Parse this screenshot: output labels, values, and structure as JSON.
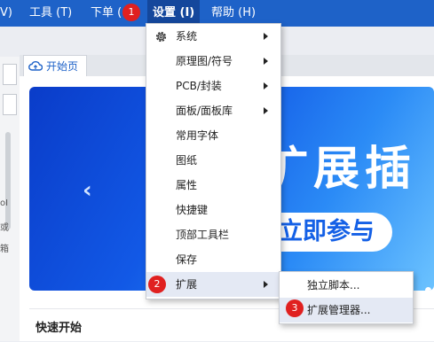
{
  "menubar": {
    "partial_item": "V)",
    "tools": "工具 (T)",
    "order": "下单 (",
    "settings": "设置 (I)",
    "help": "帮助 (H)"
  },
  "badges": [
    "1",
    "2",
    "3"
  ],
  "tab": {
    "label": "开始页"
  },
  "left_panel": {
    "text1": "oI",
    "text2": "或",
    "text3": "箱"
  },
  "settings_menu": {
    "items": [
      {
        "label": "系统",
        "has_submenu": true
      },
      {
        "label": "原理图/符号",
        "has_submenu": true
      },
      {
        "label": "PCB/封装",
        "has_submenu": true
      },
      {
        "label": "面板/面板库",
        "has_submenu": true
      },
      {
        "label": "常用字体",
        "has_submenu": false
      },
      {
        "label": "图纸",
        "has_submenu": false
      },
      {
        "label": "属性",
        "has_submenu": false
      },
      {
        "label": "快捷键",
        "has_submenu": false
      },
      {
        "label": "顶部工具栏",
        "has_submenu": false
      },
      {
        "label": "保存",
        "has_submenu": false
      },
      {
        "label": "扩展",
        "has_submenu": true
      }
    ]
  },
  "extension_submenu": {
    "items": [
      {
        "label": "独立脚本..."
      },
      {
        "label": "扩展管理器..."
      }
    ]
  },
  "banner": {
    "headline": "扩展插",
    "pill_text": "立即参与",
    "nav_prev": "‹"
  },
  "quick_start": {
    "title": "快速开始"
  },
  "colors": {
    "menubar": "#1e62c8",
    "menubar_active": "#14479c",
    "badge": "#e02020",
    "highlight": "#e4e9f4"
  },
  "icons": {
    "settings_gear": "gear-icon",
    "tab_cloud": "cloud-icon",
    "submenu_arrow": "triangle-right-icon"
  }
}
